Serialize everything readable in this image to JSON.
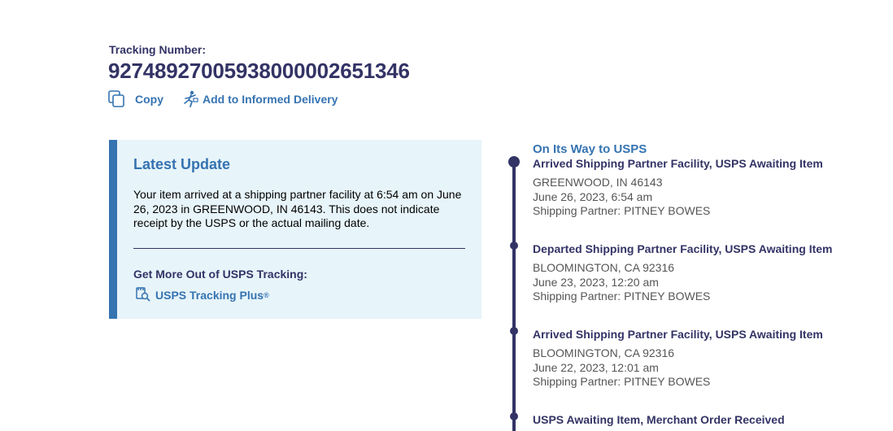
{
  "tracking": {
    "label": "Tracking Number:",
    "number": "92748927005938000002651346"
  },
  "actions": {
    "copy": "Copy",
    "informed_delivery": "Add to Informed Delivery"
  },
  "latest_update": {
    "title": "Latest Update",
    "text": "Your item arrived at a shipping partner facility at 6:54 am on June 26, 2023 in GREENWOOD, IN 46143. This does not indicate receipt by the USPS or the actual mailing date.",
    "more_title": "Get More Out of USPS Tracking:",
    "plus_label": "USPS Tracking Plus",
    "plus_reg": "®"
  },
  "timeline": {
    "status": "On Its Way to USPS",
    "events": [
      {
        "title": "Arrived Shipping Partner Facility, USPS Awaiting Item",
        "location": "GREENWOOD, IN 46143",
        "datetime": "June 26, 2023, 6:54 am",
        "partner": "Shipping Partner: PITNEY BOWES"
      },
      {
        "title": "Departed Shipping Partner Facility, USPS Awaiting Item",
        "location": "BLOOMINGTON, CA 92316",
        "datetime": "June 23, 2023, 12:20 am",
        "partner": "Shipping Partner: PITNEY BOWES"
      },
      {
        "title": "Arrived Shipping Partner Facility, USPS Awaiting Item",
        "location": "BLOOMINGTON, CA 92316",
        "datetime": "June 22, 2023, 12:01 am",
        "partner": "Shipping Partner: PITNEY BOWES"
      },
      {
        "title": "USPS Awaiting Item, Merchant Order Received"
      }
    ]
  },
  "colors": {
    "navy": "#333366",
    "link_blue": "#3573b1",
    "panel_bg": "#e7f4f9"
  },
  "icons": [
    "copy-icon",
    "informed-delivery-icon",
    "tracking-plus-icon"
  ]
}
